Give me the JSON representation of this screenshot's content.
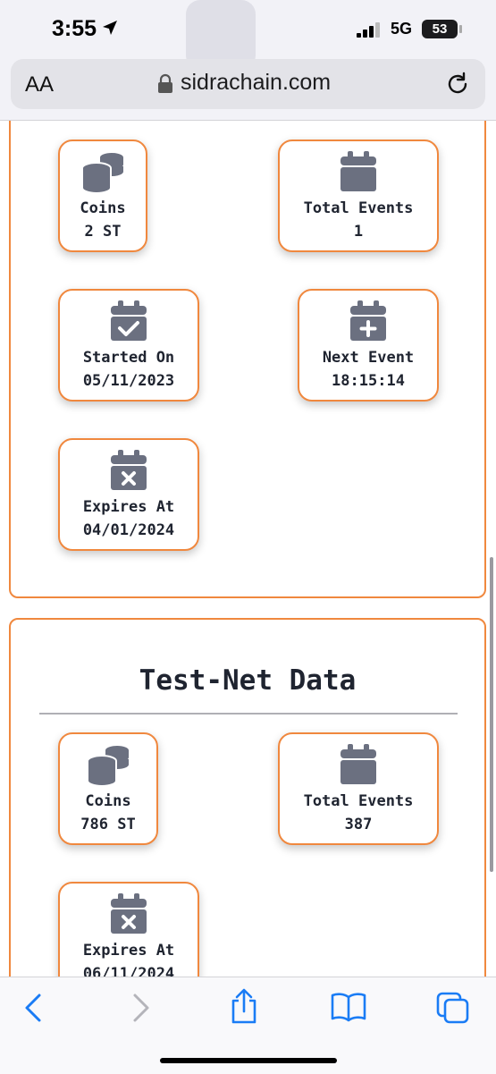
{
  "status_bar": {
    "time": "3:55",
    "network": "5G",
    "battery": "53",
    "icons": [
      "location-arrow-icon",
      "signal-icon",
      "battery-icon"
    ]
  },
  "browser": {
    "text_size_label": "AA",
    "domain": "sidrachain.com",
    "icons": [
      "lock-icon",
      "reload-icon"
    ]
  },
  "section_main": {
    "cards": [
      {
        "icon": "coins-icon",
        "label": "Coins",
        "value": "2 ST"
      },
      {
        "icon": "calendar-icon",
        "label": "Total Events",
        "value": "1"
      },
      {
        "icon": "calendar-check-icon",
        "label": "Started On",
        "value": "05/11/2023"
      },
      {
        "icon": "calendar-plus-icon",
        "label": "Next Event",
        "value": "18:15:14"
      },
      {
        "icon": "calendar-x-icon",
        "label": "Expires At",
        "value": "04/01/2024"
      }
    ]
  },
  "section_testnet": {
    "title": "Test-Net Data",
    "cards": [
      {
        "icon": "coins-icon",
        "label": "Coins",
        "value": "786 ST"
      },
      {
        "icon": "calendar-icon",
        "label": "Total Events",
        "value": "387"
      },
      {
        "icon": "calendar-x-icon",
        "label": "Expires At",
        "value": "06/11/2024"
      }
    ]
  },
  "bottom_toolbar": {
    "buttons": [
      "back-icon",
      "forward-icon",
      "share-icon",
      "bookmarks-icon",
      "tabs-icon"
    ]
  },
  "colors": {
    "accent_orange": "#f0883e",
    "icon_gray": "#6b7080",
    "text_dark": "#1f2430",
    "ios_blue": "#1a7cf5"
  }
}
